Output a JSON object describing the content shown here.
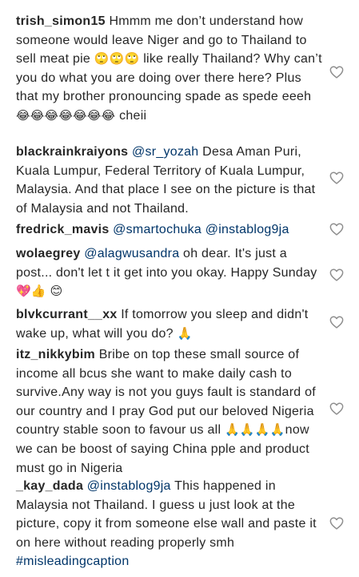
{
  "comments": [
    {
      "username": "trish_simon15",
      "parts": [
        {
          "type": "text",
          "value": "Hmmm me don’t understand how someone would leave Niger and go to Thailand to sell meat pie "
        },
        {
          "type": "emoji",
          "value": "🙄🙄🙄"
        },
        {
          "type": "text",
          "value": " like really Thailand? Why can’t you do what you are doing over there here? Plus that my brother pronouncing spade as spede eeeh "
        },
        {
          "type": "emoji",
          "value": "😂😂😂😂😂😂😂"
        },
        {
          "type": "text",
          "value": " cheii"
        }
      ]
    },
    {
      "username": "blackrainkraiyons",
      "parts": [
        {
          "type": "mention",
          "value": "@sr_yozah"
        },
        {
          "type": "text",
          "value": " Desa Aman Puri, Kuala Lumpur, Federal Territory of Kuala Lumpur, Malaysia. And that place I see on the picture is that of Malaysia and not Thailand."
        }
      ]
    },
    {
      "username": "fredrick_mavis",
      "parts": [
        {
          "type": "mention",
          "value": "@smartochuka"
        },
        {
          "type": "text",
          "value": " "
        },
        {
          "type": "mention",
          "value": "@instablog9ja"
        }
      ]
    },
    {
      "username": "wolaegrey",
      "parts": [
        {
          "type": "mention",
          "value": "@alagwusandra"
        },
        {
          "type": "text",
          "value": " oh dear. It's just a post... don't let t it get into you okay. Happy Sunday "
        },
        {
          "type": "emoji",
          "value": "💖👍"
        },
        {
          "type": "text",
          "value": " "
        },
        {
          "type": "emoji",
          "value": "😊"
        }
      ]
    },
    {
      "username": "blvkcurrant__xx",
      "parts": [
        {
          "type": "text",
          "value": "If tomorrow you sleep and didn't wake up, what will you do? "
        },
        {
          "type": "emoji",
          "value": "🙏"
        }
      ]
    },
    {
      "username": "itz_nikkybim",
      "parts": [
        {
          "type": "text",
          "value": "Bribe on top these small source of income all bcus she want to make daily cash to survive.Any way is not you guys fault is standard of our country and I pray God put our beloved Nigeria country stable soon to favour us all "
        },
        {
          "type": "emoji",
          "value": "🙏🙏🙏🙏"
        },
        {
          "type": "text",
          "value": "now we can be boost of saying China pple and product must go in Nigeria"
        }
      ]
    },
    {
      "username": "_kay_dada",
      "parts": [
        {
          "type": "mention",
          "value": "@instablog9ja"
        },
        {
          "type": "text",
          "value": " This happened in Malaysia not Thailand. I guess u just look at the picture, copy it from someone else wall and paste it on here without reading properly smh "
        },
        {
          "type": "hashtag",
          "value": "#misleadingcaption"
        }
      ]
    }
  ],
  "icons": {
    "like": "heart-outline-icon"
  },
  "colors": {
    "text": "#262626",
    "link": "#003569",
    "icon": "#8e8e8e"
  }
}
